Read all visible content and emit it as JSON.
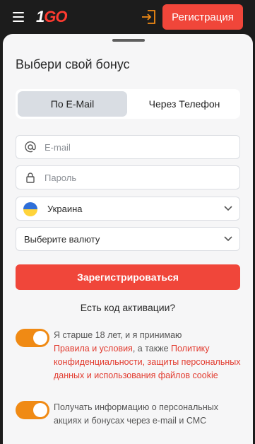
{
  "header": {
    "logo_part1": "1",
    "logo_part2": "GO",
    "register_label": "Регистрация"
  },
  "form": {
    "title": "Выбери свой бонус",
    "tabs": [
      {
        "label": "По E-Mail",
        "active": true
      },
      {
        "label": "Через Телефон",
        "active": false
      }
    ],
    "email_placeholder": "E-mail",
    "password_placeholder": "Пароль",
    "country_value": "Украина",
    "currency_value": "Выберите валюту",
    "submit_label": "Зарегистрироваться",
    "promo_label": "Есть код активации?"
  },
  "consents": {
    "age_text_1": "Я старше 18 лет, и я принимаю",
    "age_link_terms": "Правила и условия",
    "age_text_2": ", а также",
    "age_link_privacy": "Политику конфиденциальности, защиты персональных данных и использования файлов cookie",
    "news_text": "Получать информацию о персональных акциях и бонусах через e-mail и СМС"
  },
  "colors": {
    "accent": "#f0463a",
    "toggle": "#f08a14",
    "link": "#e23a2e"
  }
}
